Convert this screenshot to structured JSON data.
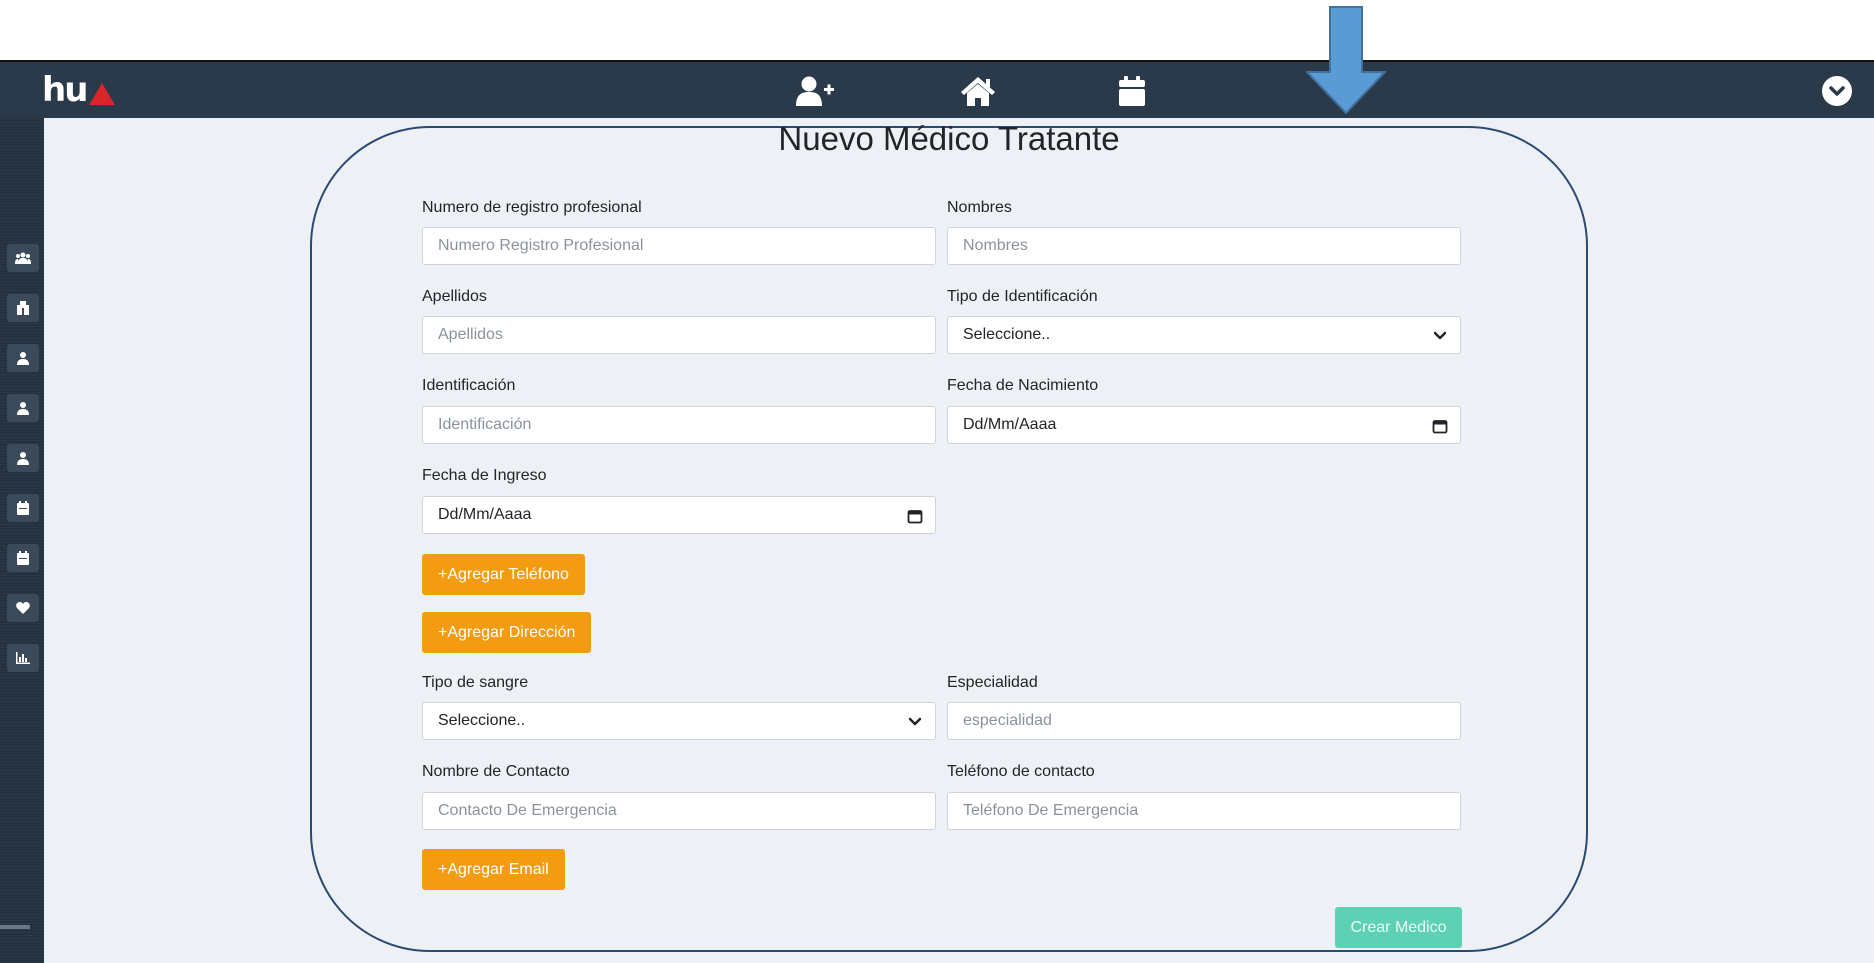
{
  "app": {
    "logo_text": "hu"
  },
  "navbar": {
    "icons": [
      "add-user-icon",
      "home-icon",
      "calendar-icon"
    ],
    "user_menu_icon": "chevron-down-circle-icon"
  },
  "sidebar": {
    "icons": [
      "users-icon",
      "hospital-icon",
      "user-icon",
      "user-icon",
      "user-icon",
      "calendar-icon",
      "calendar-icon",
      "heart-icon",
      "chart-icon"
    ]
  },
  "form": {
    "title": "Nuevo Médico Tratante",
    "registro": {
      "label": "Numero de registro profesional",
      "placeholder": "Numero Registro Profesional"
    },
    "nombres": {
      "label": "Nombres",
      "placeholder": "Nombres"
    },
    "apellidos": {
      "label": "Apellidos",
      "placeholder": "Apellidos"
    },
    "tipo_id": {
      "label": "Tipo de Identificación",
      "value": "Seleccione.."
    },
    "identificacion": {
      "label": "Identificación",
      "placeholder": "Identificación"
    },
    "fecha_nacimiento": {
      "label": "Fecha de Nacimiento",
      "value": "Dd/Mm/Aaaa"
    },
    "fecha_ingreso": {
      "label": "Fecha de Ingreso",
      "value": "Dd/Mm/Aaaa"
    },
    "add_telefono": "+Agregar Teléfono",
    "add_direccion": "+Agregar Dirección",
    "tipo_sangre": {
      "label": "Tipo de sangre",
      "value": "Seleccione.."
    },
    "especialidad": {
      "label": "Especialidad",
      "placeholder": "especialidad"
    },
    "contacto": {
      "label": "Nombre de Contacto",
      "placeholder": "Contacto De Emergencia"
    },
    "tel_contacto": {
      "label": "Teléfono de contacto",
      "placeholder": "Teléfono De Emergencia"
    },
    "add_email": "+Agregar Email",
    "submit": "Crear Medico"
  },
  "colors": {
    "navbar": "#2b3a4a",
    "accent_orange": "#f39c12",
    "submit_teal": "#5ed0b4",
    "frame_border": "#2b4a73",
    "arrow": "#5b9bd5"
  }
}
